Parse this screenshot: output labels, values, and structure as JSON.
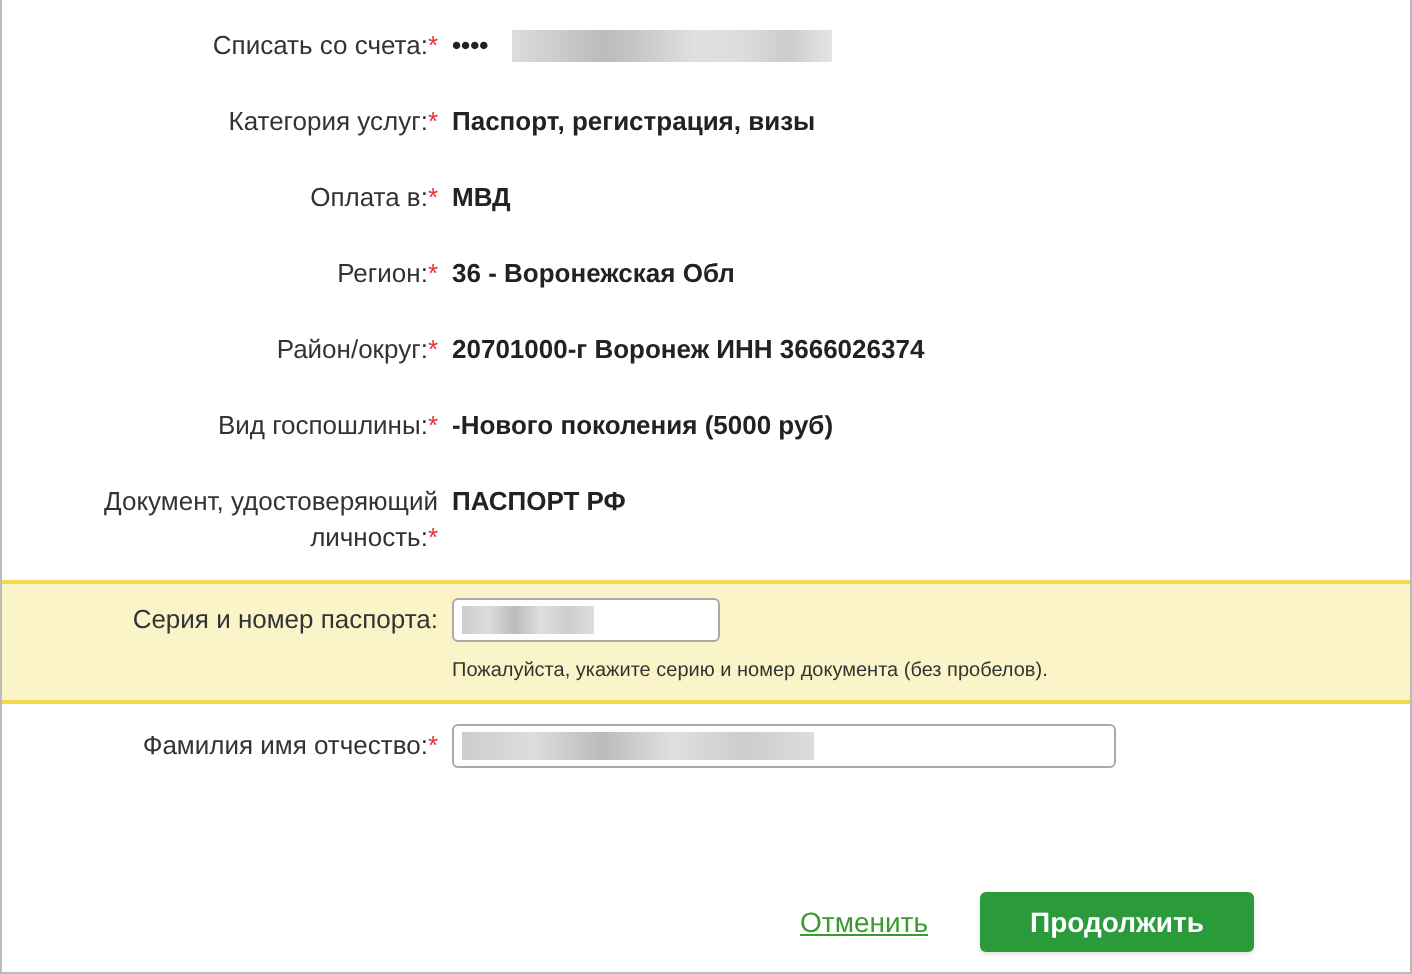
{
  "fields": [
    {
      "kind": "text",
      "label": "Списать со счета:",
      "required_mark": "*",
      "value": "••••",
      "redacted": true
    },
    {
      "kind": "text",
      "label": "Категория услуг:",
      "required_mark": "*",
      "value": "Паспорт, регистрация, визы"
    },
    {
      "kind": "text",
      "label": "Оплата в:",
      "required_mark": "*",
      "value": "МВД"
    },
    {
      "kind": "text",
      "label": "Регион:",
      "required_mark": "*",
      "value": "36 - Воронежская Обл"
    },
    {
      "kind": "text",
      "label": "Район/округ:",
      "required_mark": "*",
      "value": "20701000-г Воронеж ИНН 3666026374"
    },
    {
      "kind": "text",
      "label": "Вид госпошлины:",
      "required_mark": "*",
      "value": "-Нового поколения (5000 руб)"
    },
    {
      "kind": "text",
      "label": "Документ, удостоверяющий личность:",
      "required_mark": "*",
      "value": "ПАСПОРТ РФ"
    },
    {
      "kind": "short_input",
      "label": "Серия и номер паспорта:",
      "highlighted": true,
      "hint": "Пожалуйста, укажите серию и номер документа (без пробелов)."
    },
    {
      "kind": "long_input",
      "label": "Фамилия имя отчество:",
      "required_mark": "*",
      "highlighted": false
    }
  ],
  "actions": {
    "cancel": "Отменить",
    "submit": "Продолжить"
  }
}
